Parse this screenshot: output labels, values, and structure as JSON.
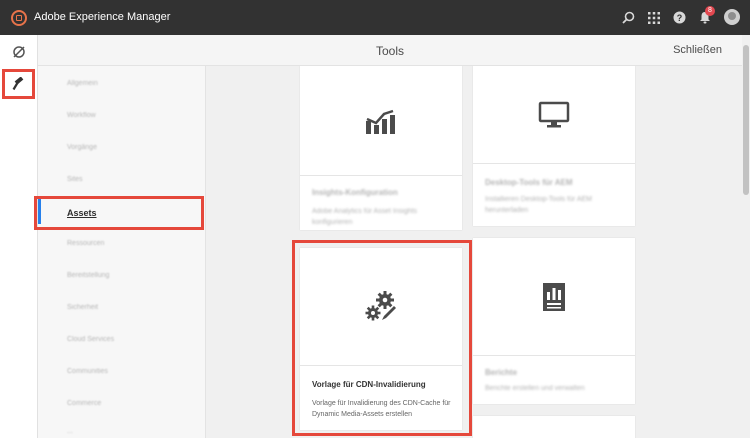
{
  "app": {
    "title": "Adobe Experience Manager",
    "notification_count": "8"
  },
  "header": {
    "title": "Tools",
    "close_label": "Schließen"
  },
  "nav": {
    "items": [
      "Allgemein",
      "Workflow",
      "Vorgänge",
      "Sites",
      "Assets",
      "Ressourcen",
      "Bereitstellung",
      "Sicherheit",
      "Cloud Services",
      "Communities",
      "Commerce",
      "..."
    ],
    "active": "Assets"
  },
  "cards": [
    {
      "title": "Insights-Konfiguration",
      "desc": "Adobe Analytics für Asset Insights konfigurieren",
      "icon": "chart-icon"
    },
    {
      "title": "Desktop-Tools für AEM",
      "desc": "Installieren Desktop-Tools für AEM herunterladen",
      "icon": "monitor-icon"
    },
    {
      "title": "Vorlage für CDN-Invalidierung",
      "desc": "Vorlage für Invalidierung des CDN-Cache für Dynamic Media-Assets erstellen",
      "icon": "gears-edit-icon"
    },
    {
      "title": "Berichte",
      "desc": "Berichte erstellen und verwalten",
      "icon": "report-icon"
    }
  ],
  "colors": {
    "topbar": "#323232",
    "highlight": "#e5483b",
    "accent": "#2680eb",
    "logo": "#e8734a"
  }
}
